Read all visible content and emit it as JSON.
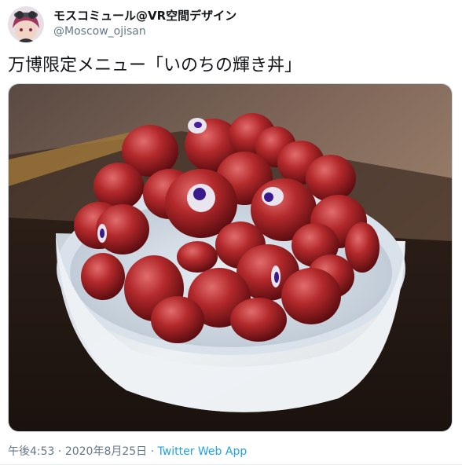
{
  "author": {
    "display_name": "モスコミュール@VR空間デザイン",
    "handle": "@Moscow_ojisan"
  },
  "tweet": {
    "text": "万博限定メニュー「いのちの輝き丼」"
  },
  "meta": {
    "time": "午後4:53",
    "separator1": " · ",
    "date": "2020年8月25日",
    "separator2": " · ",
    "source": "Twitter Web App"
  },
  "colors": {
    "link": "#1da1f2",
    "secondary_text": "#657786",
    "primary_text": "#14171a"
  }
}
